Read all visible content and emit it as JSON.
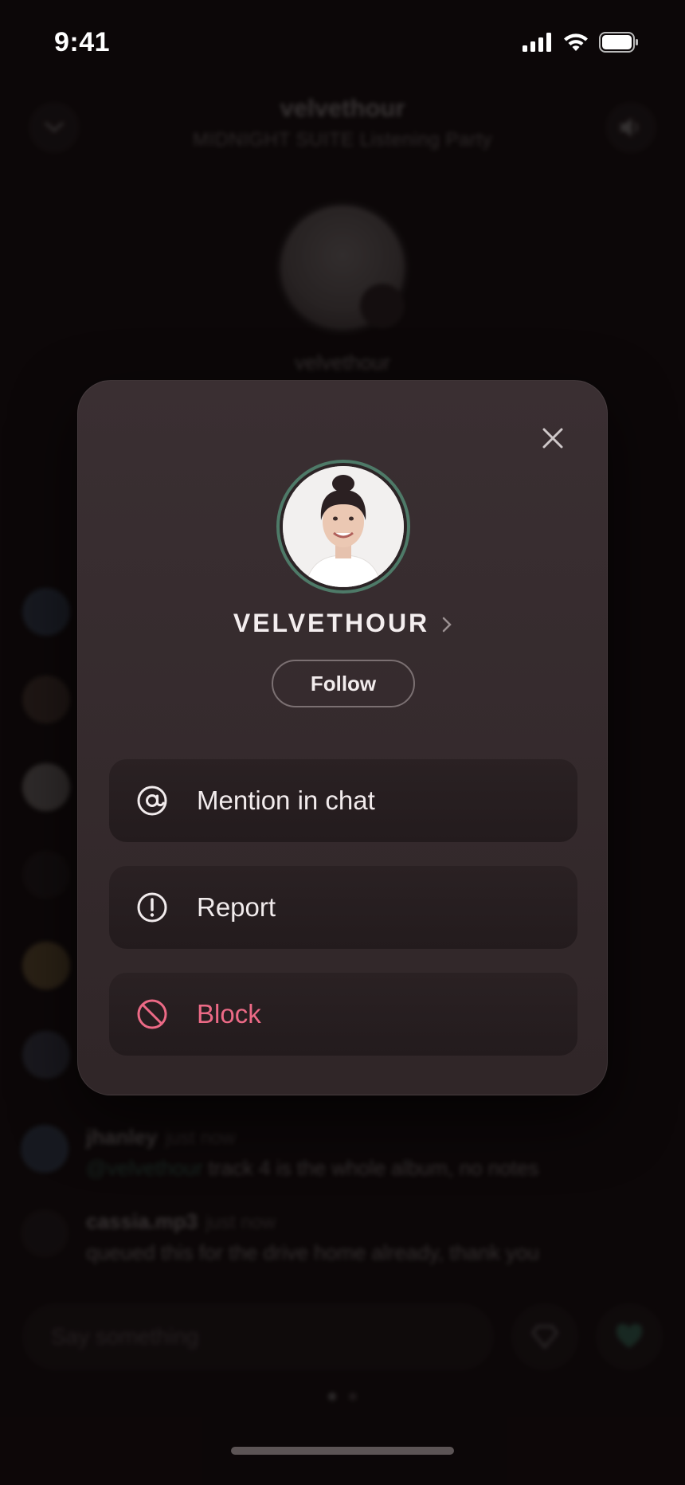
{
  "status_bar": {
    "time": "9:41",
    "icons": [
      "cellular-signal-icon",
      "wifi-icon",
      "battery-icon"
    ]
  },
  "background": {
    "host_name": "velvethour",
    "subtitle": "MIDNIGHT SUITE Listening Party",
    "host_label": "velvethour",
    "chat": [
      {
        "user": "jhanley",
        "time": "just now",
        "mention": "@velvethour",
        "text": " track 4 is the whole album, no notes"
      },
      {
        "user": "cassia.mp3",
        "time": "just now",
        "mention": "",
        "text": "queued this for the drive home already, thank you"
      }
    ],
    "input_placeholder": "Say something"
  },
  "modal": {
    "username": "VELVETHOUR",
    "follow_label": "Follow",
    "actions": [
      {
        "label": "Mention in chat",
        "icon": "at-sign-icon"
      },
      {
        "label": "Report",
        "icon": "alert-circle-icon"
      },
      {
        "label": "Block",
        "icon": "block-icon"
      }
    ]
  },
  "colors": {
    "modal_bg": "#352b2e",
    "accent_green": "#4e7a68",
    "danger": "#ec6a86"
  }
}
